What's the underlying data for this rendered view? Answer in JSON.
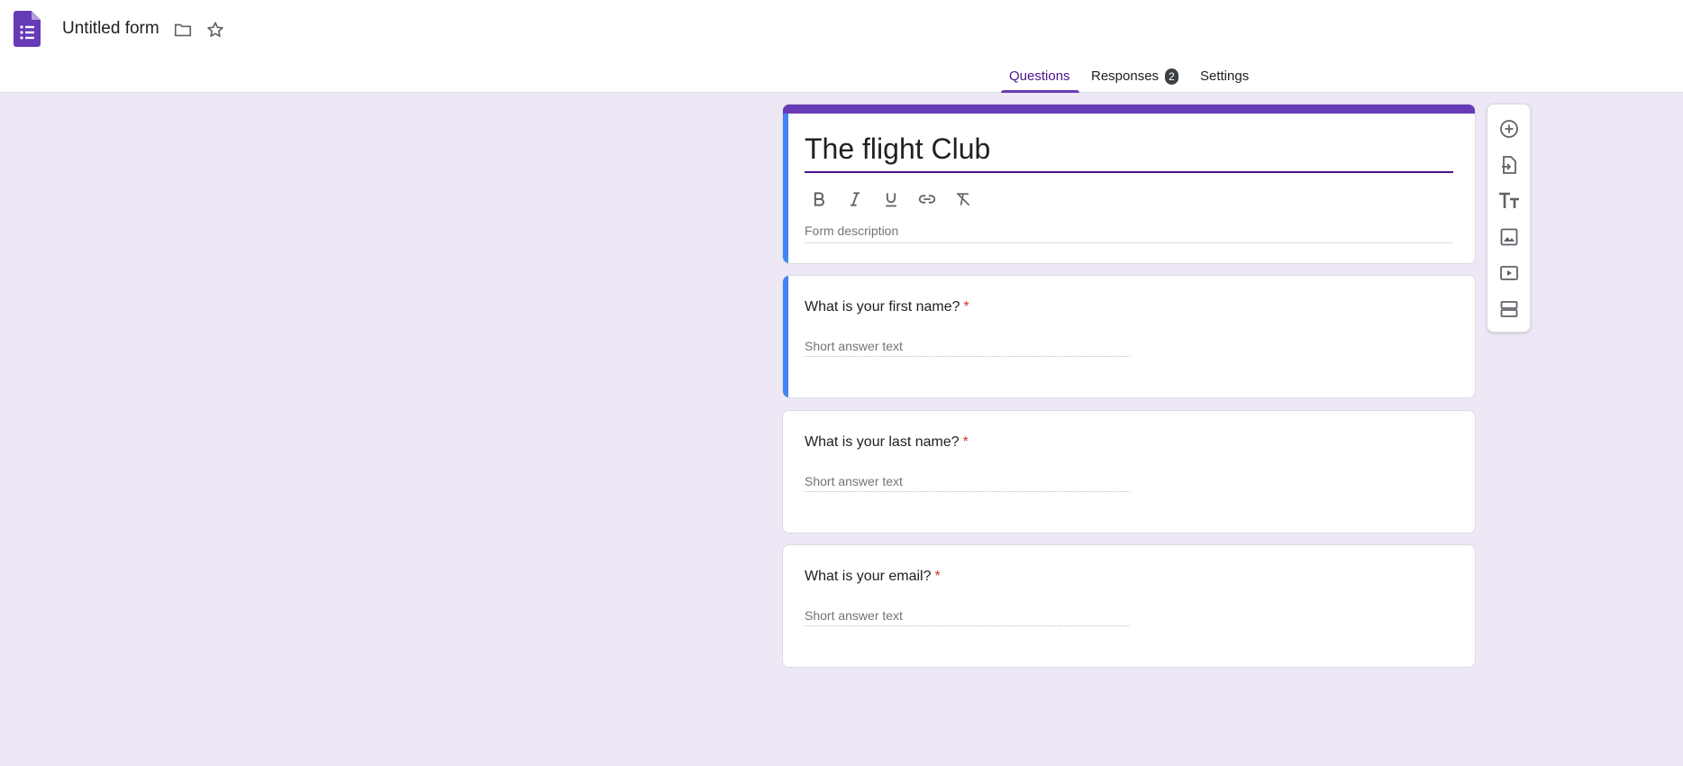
{
  "header": {
    "doc_title": "Untitled form",
    "icons": [
      "forms-logo-icon",
      "folder-icon",
      "star-icon"
    ]
  },
  "tabs": [
    {
      "label": "Questions",
      "active": true
    },
    {
      "label": "Responses",
      "badge": "2"
    },
    {
      "label": "Settings"
    }
  ],
  "form": {
    "title": "The flight Club",
    "description_placeholder": "Form description",
    "format_tools": [
      "bold-icon",
      "italic-icon",
      "underline-icon",
      "link-icon",
      "clear-format-icon"
    ]
  },
  "questions": [
    {
      "title": "What is your first name?",
      "required_mark": "*",
      "answer_placeholder": "Short answer text",
      "active": true
    },
    {
      "title": "What is your last name?",
      "required_mark": "*",
      "answer_placeholder": "Short answer text"
    },
    {
      "title": "What is your email?",
      "required_mark": "*",
      "answer_placeholder": "Short answer text"
    }
  ],
  "side_toolbar": [
    "add-question-icon",
    "import-questions-icon",
    "add-title-icon",
    "add-image-icon",
    "add-video-icon",
    "add-section-icon"
  ],
  "colors": {
    "accent": "#673ab7",
    "background": "#ede7f6",
    "active_bar": "#4285f4",
    "required": "#d93025"
  }
}
